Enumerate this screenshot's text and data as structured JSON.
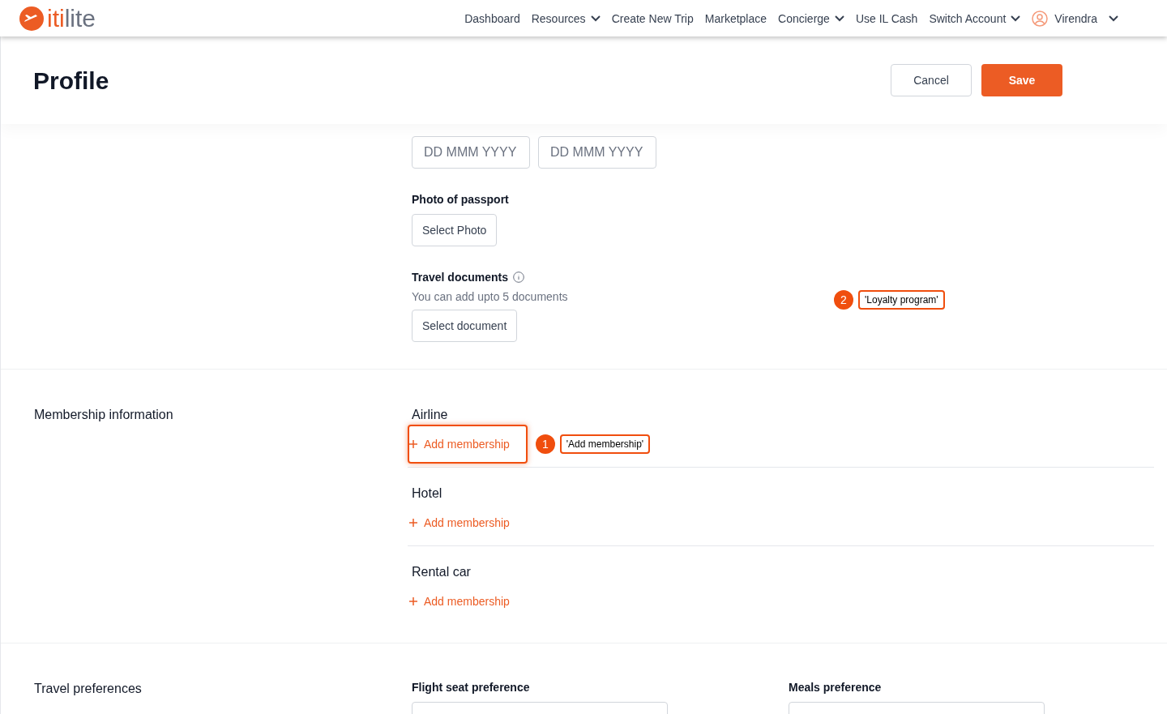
{
  "logo": {
    "parts": [
      "iti",
      "lite"
    ]
  },
  "nav": [
    {
      "label": "Dashboard",
      "dropdown": false
    },
    {
      "label": "Resources",
      "dropdown": true
    },
    {
      "label": "Create New Trip",
      "dropdown": false
    },
    {
      "label": "Marketplace",
      "dropdown": false
    },
    {
      "label": "Concierge",
      "dropdown": true
    },
    {
      "label": "Use IL Cash",
      "dropdown": false
    },
    {
      "label": "Switch Account",
      "dropdown": true
    }
  ],
  "user": {
    "name": "Virendra"
  },
  "page": {
    "title": "Profile",
    "buttons": [
      {
        "label": "Cancel",
        "kind": "secondary"
      },
      {
        "label": "Save",
        "kind": "primary"
      }
    ]
  },
  "passport": {
    "date_fields": [
      {
        "placeholder": "DD MMM YYYY"
      },
      {
        "placeholder": "DD MMM YYYY"
      }
    ],
    "photo_label": "Photo of passport",
    "photo_button": "Select Photo",
    "docs_label": "Travel documents",
    "docs_hint": "You can add upto 5 documents",
    "docs_button": "Select document"
  },
  "membership": {
    "title": "Membership information",
    "groups": [
      {
        "label": "Airline",
        "action": "Add membership",
        "highlighted": true
      },
      {
        "label": "Hotel",
        "action": "Add membership",
        "highlighted": false
      },
      {
        "label": "Rental car",
        "action": "Add membership",
        "highlighted": false
      }
    ]
  },
  "travel_preferences": {
    "title": "Travel preferences",
    "fields": [
      {
        "label": "Flight seat preference"
      },
      {
        "label": "Meals preference"
      }
    ]
  },
  "annotations": [
    {
      "number": "1",
      "text": "'Add membership'"
    },
    {
      "number": "2",
      "text": "'Loyalty program'"
    }
  ]
}
